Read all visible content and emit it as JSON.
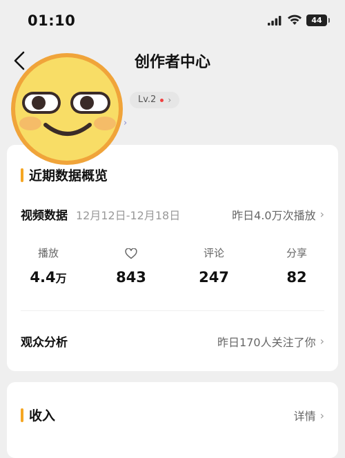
{
  "status_bar": {
    "time": "01:10",
    "battery": "44"
  },
  "header": {
    "title": "创作者中心"
  },
  "profile": {
    "level": "Lv.2"
  },
  "overview": {
    "title": "近期数据概览",
    "video": {
      "label": "视频数据",
      "date_range": "12月12日-12月18日",
      "summary": "昨日4.0万次播放"
    },
    "stats": [
      {
        "label": "播放",
        "value": "4.4",
        "unit": "万"
      },
      {
        "label": "",
        "icon": "heart-icon",
        "value": "843"
      },
      {
        "label": "评论",
        "value": "247"
      },
      {
        "label": "分享",
        "value": "82"
      }
    ],
    "audience": {
      "label": "观众分析",
      "summary": "昨日170人关注了你"
    }
  },
  "income": {
    "title": "收入",
    "detail": "详情"
  },
  "colors": {
    "accent": "#f5a623",
    "background": "#efefef",
    "card": "#ffffff"
  }
}
